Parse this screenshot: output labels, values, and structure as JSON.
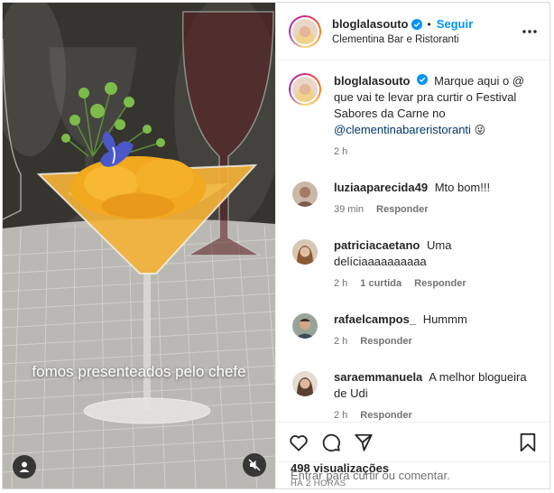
{
  "media": {
    "overlay_text": "fomos presenteados pelo chefe"
  },
  "post": {
    "username": "bloglalasouto",
    "follow_label": "Seguir",
    "dot": "•",
    "location": "Clementina Bar e Ristoranti",
    "caption_text": "Marque aqui o @ que vai te levar pra curtir o Festival Sabores da Carne no",
    "caption_mention": "@clementinabareristoranti",
    "caption_emoji": "😜",
    "caption_time": "2 h"
  },
  "comments": [
    {
      "username": "luziaaparecida49",
      "text": "Mto bom!!!",
      "time": "39 min",
      "likes": "",
      "reply": "Responder"
    },
    {
      "username": "patriciacaetano",
      "text": "Uma delíciaaaaaaaaaa",
      "time": "2 h",
      "likes": "1 curtida",
      "reply": "Responder"
    },
    {
      "username": "rafaelcampos_",
      "text": "Hummm",
      "time": "2 h",
      "likes": "",
      "reply": "Responder"
    },
    {
      "username": "saraemmanuela",
      "text": "A melhor blogueira de Udi",
      "time": "2 h",
      "likes": "",
      "reply": "Responder"
    }
  ],
  "stats": {
    "views": "498 visualizações",
    "posted": "HÁ 2 HORAS"
  },
  "login": {
    "link": "Entrar",
    "text": "para curtir ou comentar."
  },
  "icons": [
    "verified-icon",
    "more-icon",
    "heart-icon",
    "comment-icon",
    "share-icon",
    "bookmark-icon",
    "user-icon",
    "mute-icon"
  ],
  "colors": {
    "accent": "#0095f6",
    "text": "#262626",
    "muted": "#737373",
    "mention": "#00376b"
  }
}
